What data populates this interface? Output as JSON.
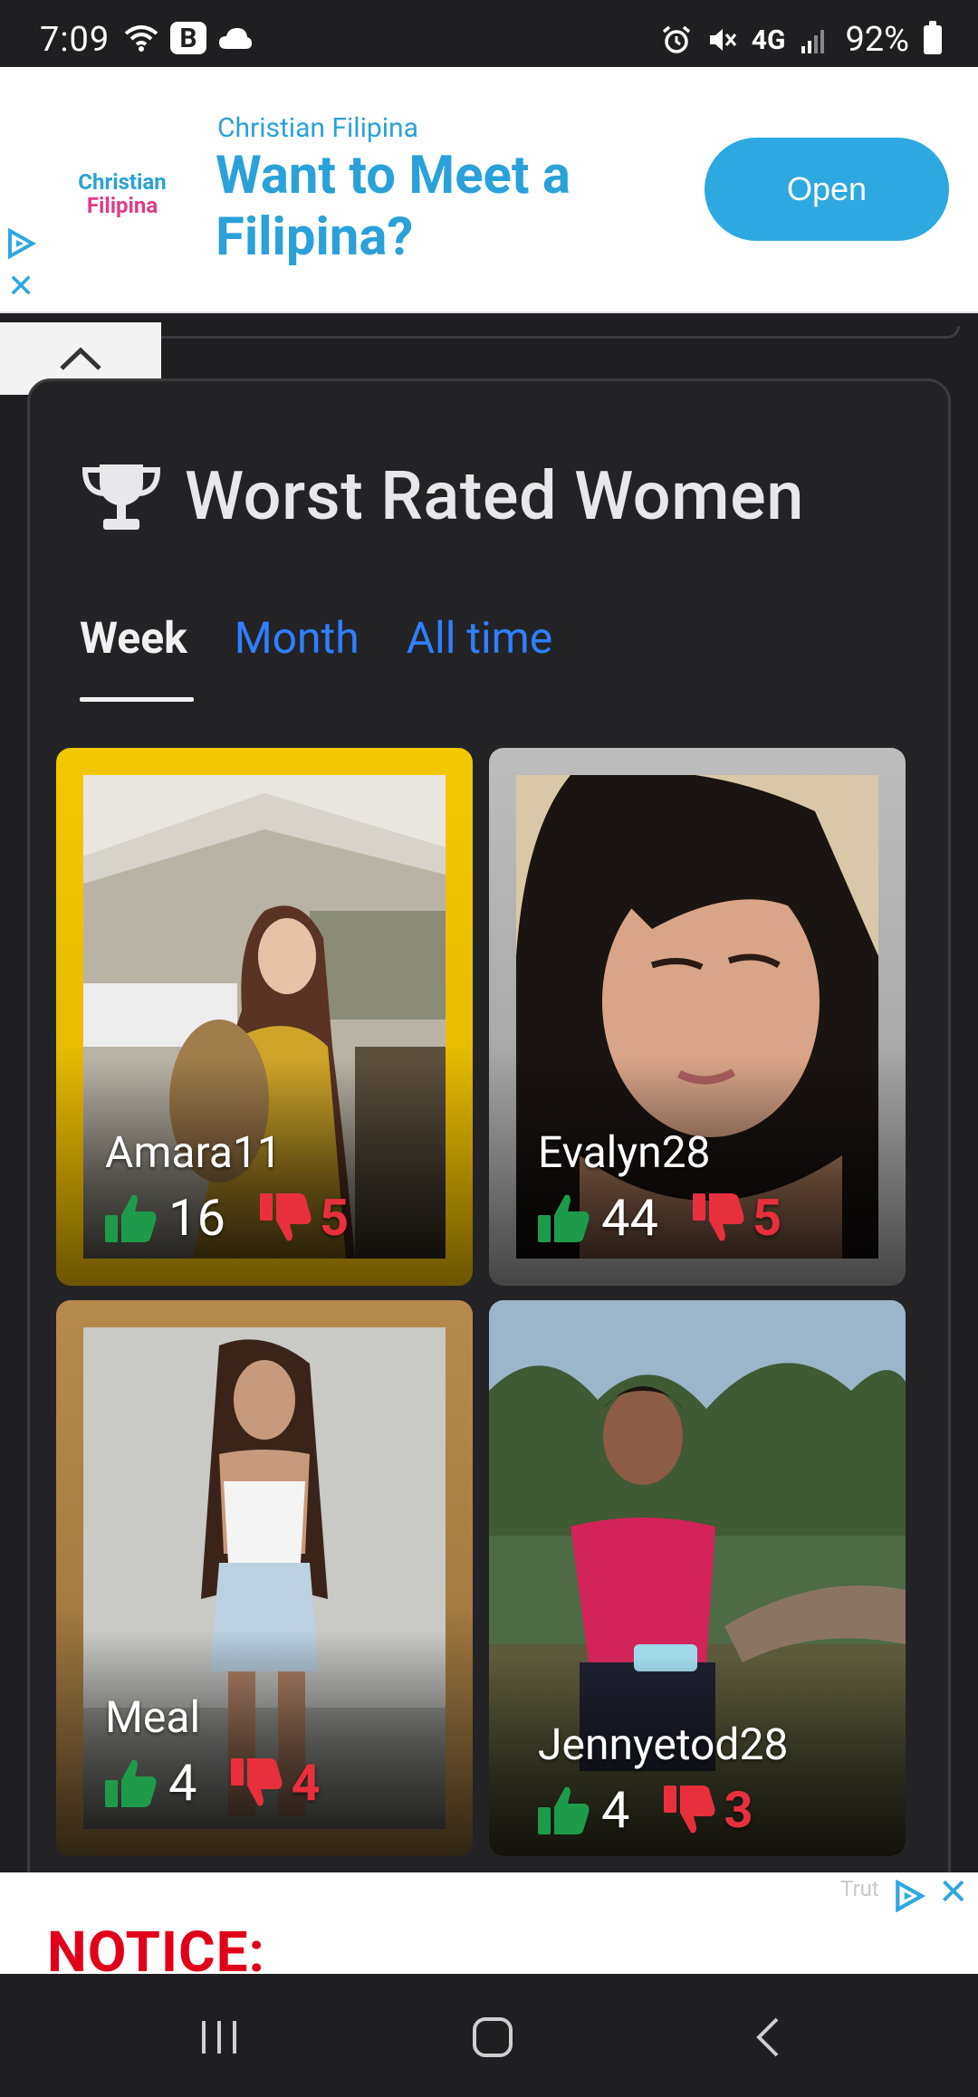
{
  "status": {
    "time": "7:09",
    "badge": "B",
    "network": "4G",
    "battery": "92%"
  },
  "ad_top": {
    "logo_line1": "Christian",
    "logo_line2": "Filipina",
    "small": "Christian Filipina",
    "headline": "Want to Meet a Filipina?",
    "button": "Open",
    "close": "✕"
  },
  "section": {
    "title": "Worst Rated Women",
    "icon": "trophy-icon"
  },
  "tabs": [
    {
      "label": "Week",
      "active": true
    },
    {
      "label": "Month",
      "active": false
    },
    {
      "label": "All time",
      "active": false
    }
  ],
  "cards": [
    {
      "name": "Amara11",
      "up": "16",
      "down": "5",
      "frame": "#f4c800"
    },
    {
      "name": "Evalyn28",
      "up": "44",
      "down": "5",
      "frame": "#bdbdbd"
    },
    {
      "name": "Meal",
      "up": "4",
      "down": "4",
      "frame": "#b58a4c"
    },
    {
      "name": "Jennyetod28",
      "up": "4",
      "down": "3",
      "frame": "none"
    }
  ],
  "ad_bottom": {
    "text": "NOTICE:",
    "faint": "Trut",
    "close": "✕"
  },
  "colors": {
    "accent": "#2f7fff",
    "thumbs_up": "#1e9b4a",
    "thumbs_down": "#e8303d",
    "ad_blue": "#2ea8e0"
  }
}
